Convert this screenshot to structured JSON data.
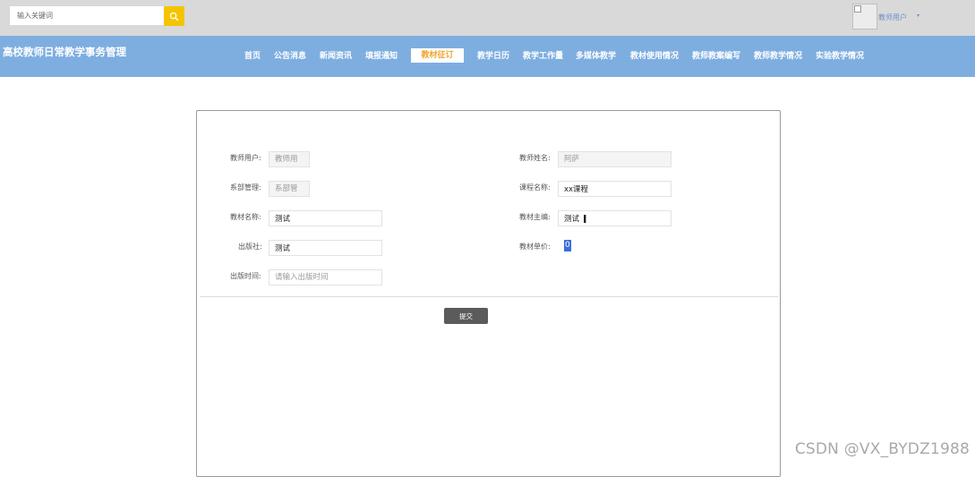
{
  "search": {
    "placeholder": "输入关键词",
    "icon": "search-icon"
  },
  "user": {
    "name": "教师用户",
    "caret": "▾"
  },
  "site": {
    "title": "高校教师日常教学事务管理"
  },
  "nav": {
    "items": [
      {
        "label": "首页"
      },
      {
        "label": "公告消息"
      },
      {
        "label": "新闻资讯"
      },
      {
        "label": "填报通知"
      },
      {
        "label": "教材征订",
        "active": true
      },
      {
        "label": "教学日历"
      },
      {
        "label": "教学工作量"
      },
      {
        "label": "多媒体教学"
      },
      {
        "label": "教材使用情况"
      },
      {
        "label": "教师教案编写"
      },
      {
        "label": "教师教学情况"
      },
      {
        "label": "实验教学情况"
      }
    ],
    "active_color": "#f0a42a",
    "bar_color": "#7eaee0"
  },
  "form": {
    "teacher_account": {
      "label": "教师用户:",
      "placeholder": "教师用"
    },
    "teacher_name": {
      "label": "教师姓名:",
      "placeholder": "阿萨"
    },
    "department": {
      "label": "系部管理:",
      "placeholder": "系部管"
    },
    "course_name": {
      "label": "课程名称:",
      "value": "xx课程"
    },
    "textbook_name": {
      "label": "教材名称:",
      "value": "测试"
    },
    "textbook_editor": {
      "label": "教材主编:",
      "value": "测试"
    },
    "publisher": {
      "label": "出版社:",
      "value": "测试"
    },
    "textbook_price": {
      "label": "教材单价:",
      "value": "0"
    },
    "publish_time": {
      "label": "出版时间:",
      "placeholder": "请输入出版时间"
    },
    "submit_label": "提交"
  },
  "watermark": "CSDN @VX_BYDZ1988"
}
